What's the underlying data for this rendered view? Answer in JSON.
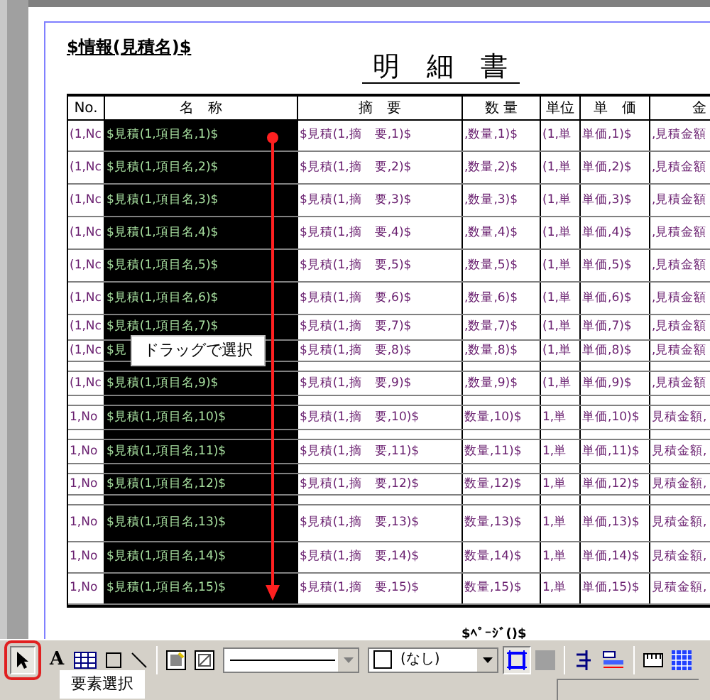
{
  "document": {
    "title": "$情報(見積名)$",
    "heading": "明　細　書",
    "footer": "$ﾍﾟｰｼﾞ()$"
  },
  "table": {
    "columns": [
      "No.",
      "名　称",
      "摘　要",
      "数 量",
      "単位",
      "単　価",
      "金"
    ],
    "rows": [
      {
        "cells": [
          "(1,Nc",
          "$見積(1,項目名,1)$",
          "$見積(1,摘　要,1)$",
          ",数量,1)$",
          "(1,単",
          "単価,1)$",
          ",見積金額"
        ],
        "gap_after": false
      },
      {
        "cells": [
          "(1,Nc",
          "$見積(1,項目名,2)$",
          "$見積(1,摘　要,2)$",
          ",数量,2)$",
          "(1,単",
          "単価,2)$",
          ",見積金額"
        ],
        "gap_after": false
      },
      {
        "cells": [
          "(1,Nc",
          "$見積(1,項目名,3)$",
          "$見積(1,摘　要,3)$",
          ",数量,3)$",
          "(1,単",
          "単価,3)$",
          ",見積金額"
        ],
        "gap_after": false
      },
      {
        "cells": [
          "(1,Nc",
          "$見積(1,項目名,4)$",
          "$見積(1,摘　要,4)$",
          ",数量,4)$",
          "(1,単",
          "単価,4)$",
          ",見積金額"
        ],
        "gap_after": false
      },
      {
        "cells": [
          "(1,Nc",
          "$見積(1,項目名,5)$",
          "$見積(1,摘　要,5)$",
          ",数量,5)$",
          "(1,単",
          "単価,5)$",
          ",見積金額"
        ],
        "gap_after": false
      },
      {
        "cells": [
          "(1,Nc",
          "$見積(1,項目名,6)$",
          "$見積(1,摘　要,6)$",
          ",数量,6)$",
          "(1,単",
          "単価,6)$",
          ",見積金額"
        ],
        "gap_after": false
      },
      {
        "cells": [
          "(1,Nc",
          "$見積(1,項目名,7)$",
          "$見積(1,摘　要,7)$",
          ",数量,7)$",
          "(1,単",
          "単価,7)$",
          ",見積金額"
        ],
        "gap_after": false
      },
      {
        "cells": [
          "(1,Nc",
          "$見",
          "$見積(1,摘　要,8)$",
          ",数量,8)$",
          "(1,単",
          "単価,8)$",
          ",見積金額"
        ],
        "gap_after": true
      },
      {
        "cells": [
          "(1,Nc",
          "$見積(1,項目名,9)$",
          "$見積(1,摘　要,9)$",
          ",数量,9)$",
          "(1,単",
          "単価,9)$",
          ",見積金額"
        ],
        "gap_after": true
      },
      {
        "cells": [
          "1,No",
          "$見積(1,項目名,10)$",
          "$見積(1,摘　要,10)$",
          "数量,10)$",
          "1,単",
          "単価,10)$",
          "見積金額,"
        ],
        "gap_after": true
      },
      {
        "cells": [
          "1,No",
          "$見積(1,項目名,11)$",
          "$見積(1,摘　要,11)$",
          "数量,11)$",
          "1,単",
          "単価,11)$",
          "見積金額,"
        ],
        "gap_after": true
      },
      {
        "cells": [
          "1,No",
          "$見積(1,項目名,12)$",
          "$見積(1,摘　要,12)$",
          "数量,12)$",
          "1,単",
          "単価,12)$",
          "見積金額,"
        ],
        "gap_after": true
      },
      {
        "cells": [
          "1,No",
          "$見積(1,項目名,13)$",
          "$見積(1,摘　要,13)$",
          "数量,13)$",
          "1,単",
          "単価,13)$",
          "見積金額,"
        ],
        "gap_after": false
      },
      {
        "cells": [
          "1,No",
          "$見積(1,項目名,14)$",
          "$見積(1,摘　要,14)$",
          "数量,14)$",
          "1,単",
          "単価,14)$",
          "見積金額,"
        ],
        "gap_after": false
      },
      {
        "cells": [
          "1,No",
          "$見積(1,項目名,15)$",
          "$見積(1,摘　要,15)$",
          "数量,15)$",
          "1,単",
          "単価,15)$",
          "見積金額,"
        ],
        "gap_after": false
      }
    ]
  },
  "drag_hint": "ドラッグで選択",
  "toolbar": {
    "tools": [
      {
        "kind": "pointer",
        "selected": true
      },
      {
        "kind": "text",
        "label": "A",
        "selected": false
      },
      {
        "kind": "table",
        "selected": false
      },
      {
        "kind": "rect",
        "selected": false
      },
      {
        "kind": "line",
        "selected": false
      },
      {
        "kind": "sep"
      },
      {
        "kind": "image",
        "selected": false
      },
      {
        "kind": "image2",
        "selected": false
      },
      {
        "kind": "linestyle"
      },
      {
        "kind": "color",
        "label": "(なし)"
      },
      {
        "kind": "frame",
        "selected": true
      },
      {
        "kind": "grid",
        "selected": false
      },
      {
        "kind": "sep"
      },
      {
        "kind": "align",
        "selected": false
      },
      {
        "kind": "layout",
        "selected": false
      },
      {
        "kind": "sep"
      },
      {
        "kind": "ruler",
        "selected": false
      },
      {
        "kind": "pattern",
        "selected": false
      }
    ]
  },
  "tooltip": "要素選択"
}
